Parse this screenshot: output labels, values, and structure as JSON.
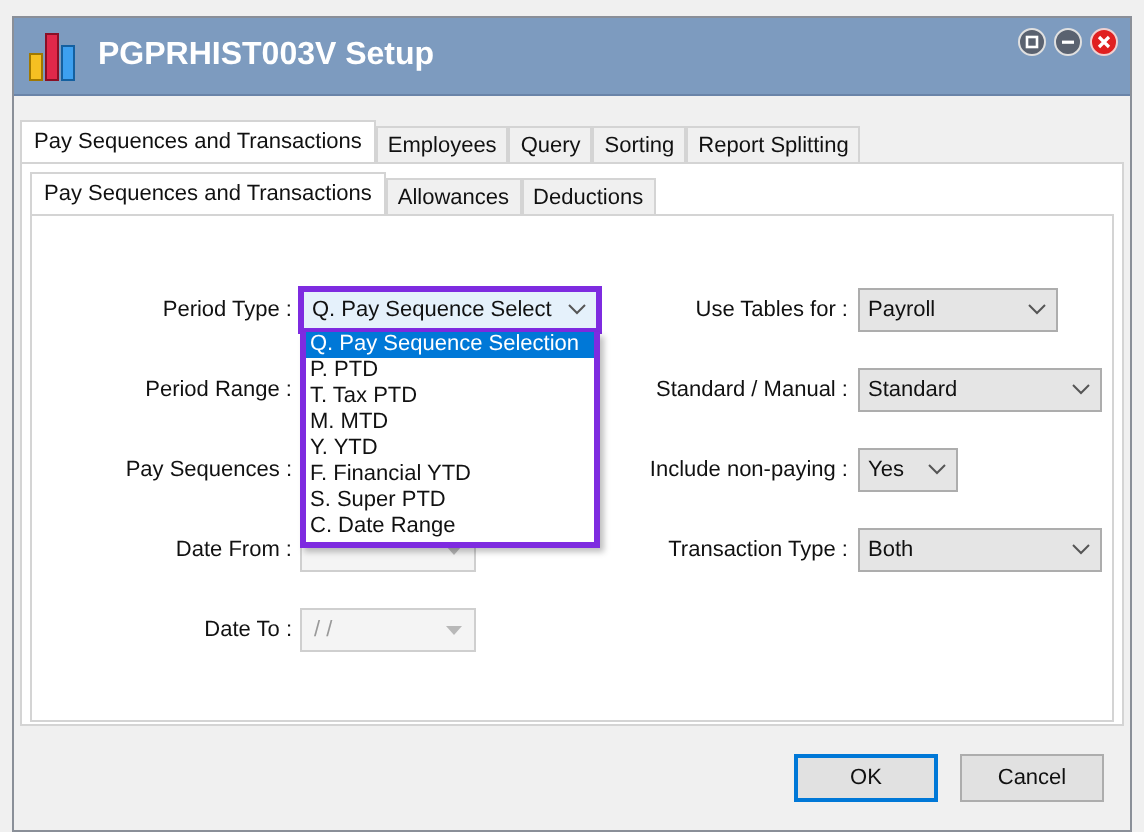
{
  "window": {
    "title": "PGPRHIST003V Setup"
  },
  "tabs": [
    {
      "label": "Pay Sequences and Transactions",
      "selected": true
    },
    {
      "label": "Employees",
      "selected": false
    },
    {
      "label": "Query",
      "selected": false
    },
    {
      "label": "Sorting",
      "selected": false
    },
    {
      "label": "Report Splitting",
      "selected": false
    }
  ],
  "sub_tabs": [
    {
      "label": "Pay Sequences and Transactions",
      "selected": true
    },
    {
      "label": "Allowances",
      "selected": false
    },
    {
      "label": "Deductions",
      "selected": false
    }
  ],
  "left_fields": [
    {
      "label": "Period Type :",
      "kind": "open_combo",
      "value": "Q. Pay Sequence Select"
    },
    {
      "label": "Period Range :",
      "kind": "covered"
    },
    {
      "label": "Pay Sequences :",
      "kind": "covered"
    },
    {
      "label": "Date From :",
      "kind": "date"
    },
    {
      "label": "Date To :",
      "kind": "date",
      "placeholder": "/ /"
    }
  ],
  "dropdown_options": [
    {
      "label": "Q. Pay Sequence Selection",
      "selected": true
    },
    {
      "label": "P. PTD",
      "selected": false
    },
    {
      "label": "T. Tax PTD",
      "selected": false
    },
    {
      "label": "M. MTD",
      "selected": false
    },
    {
      "label": "Y. YTD",
      "selected": false
    },
    {
      "label": "F. Financial YTD",
      "selected": false
    },
    {
      "label": "S. Super PTD",
      "selected": false
    },
    {
      "label": "C. Date Range",
      "selected": false
    }
  ],
  "right_fields": [
    {
      "label": "Use Tables for :",
      "value": "Payroll"
    },
    {
      "label": "Standard / Manual :",
      "value": "Standard"
    },
    {
      "label": "Include non-paying :",
      "value": "Yes"
    },
    {
      "label": "Transaction Type :",
      "value": "Both"
    }
  ],
  "buttons": [
    {
      "label": "OK",
      "default": true
    },
    {
      "label": "Cancel",
      "default": false
    }
  ]
}
